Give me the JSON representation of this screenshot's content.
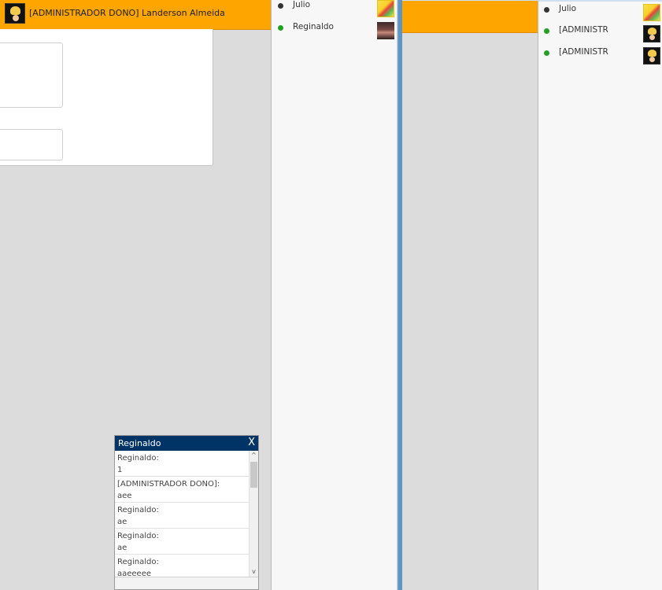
{
  "left_header": {
    "title": "[ADMINISTRADOR DONO] Landerson Almeida"
  },
  "contacts_left": [
    {
      "name": "Julio",
      "status": "offline",
      "status_color": "#333333"
    },
    {
      "name": "Reginaldo",
      "status": "online",
      "status_color": "#22a022"
    }
  ],
  "contacts_right": [
    {
      "name": "Julio",
      "status": "offline",
      "status_color": "#333333"
    },
    {
      "name": "[ADMINISTR",
      "status": "online",
      "status_color": "#22a022"
    },
    {
      "name": "[ADMINISTR",
      "status": "online",
      "status_color": "#22a022"
    }
  ],
  "chat": {
    "title": "Reginaldo",
    "close_label": "X",
    "scroll_up": "^",
    "scroll_down": "v",
    "messages": [
      {
        "sender": "Reginaldo:",
        "text": "1"
      },
      {
        "sender": "[ADMINISTRADOR DONO]:",
        "text": "aee"
      },
      {
        "sender": "Reginaldo:",
        "text": "ae"
      },
      {
        "sender": "Reginaldo:",
        "text": "ae"
      },
      {
        "sender": "Reginaldo:",
        "text": "aaeeeee"
      }
    ]
  },
  "colors": {
    "accent_orange": "#ffa500",
    "chat_header": "#003366",
    "divider_blue": "#5e95c7"
  }
}
